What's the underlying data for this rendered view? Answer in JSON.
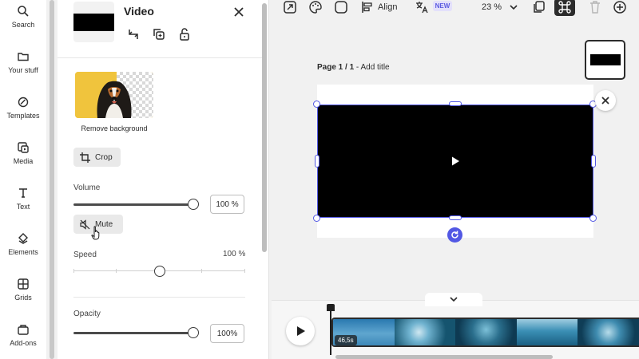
{
  "rail": {
    "items": [
      {
        "label": "Search",
        "icon": "search-icon"
      },
      {
        "label": "Your stuff",
        "icon": "folder-icon"
      },
      {
        "label": "Templates",
        "icon": "templates-icon"
      },
      {
        "label": "Media",
        "icon": "media-icon"
      },
      {
        "label": "Text",
        "icon": "text-icon"
      },
      {
        "label": "Elements",
        "icon": "elements-icon"
      },
      {
        "label": "Grids",
        "icon": "grids-icon"
      },
      {
        "label": "Add-ons",
        "icon": "addons-icon"
      }
    ]
  },
  "panel": {
    "title": "Video",
    "remove_background": "Remove background",
    "crop": "Crop",
    "volume": {
      "label": "Volume",
      "value": "100 %",
      "level": 1.0
    },
    "mute": "Mute",
    "speed": {
      "label": "Speed",
      "value": "100 %",
      "level": 0.5
    },
    "opacity": {
      "label": "Opacity",
      "value": "100%",
      "level": 1.0
    }
  },
  "toolbar": {
    "align": "Align",
    "new_badge": "NEW",
    "zoom": "23 %"
  },
  "canvas": {
    "page_number": "Page 1 / 1",
    "page_title_placeholder": " - Add title"
  },
  "timeline": {
    "duration": "46,5s"
  },
  "colors": {
    "accent": "#5258e4",
    "ink": "#2c2c2c"
  }
}
